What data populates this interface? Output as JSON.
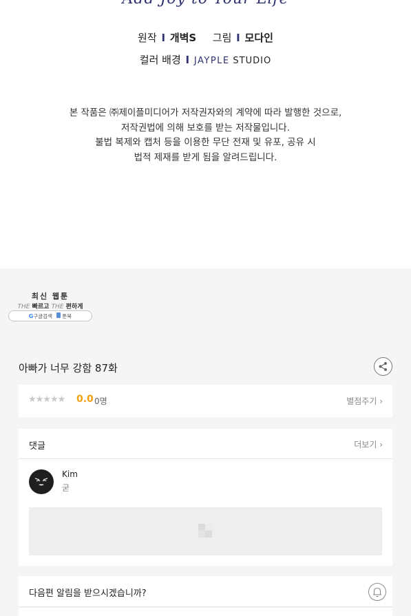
{
  "header": {
    "cut_title": "Add Joy to Your Life"
  },
  "credits": {
    "original_label": "원작",
    "original_name": "개벽S",
    "art_label": "그림",
    "art_name": "모다인",
    "color_label": "컬러 배경",
    "separator": "I",
    "studio_brand": "JAYPLE",
    "studio_word": "STUDIO"
  },
  "notice": {
    "line1": "본 작품은 ㈜제이플미디어가 저작권자와의 계약에 따라 발행한 것으로,",
    "line2": "저작권법에 의해 보호를 받는 저작물입니다.",
    "line3": "불법 복제와 캡처 등을 이용한 무단 전재 및 유포, 공유 시",
    "line4": "법적 제재를 받게 됨을 알려드립니다."
  },
  "banner": {
    "title": "최신 웹툰",
    "the1": "THE",
    "fast": "빠르고",
    "the2": "THE",
    "easy": "편하게",
    "google_g": "G",
    "google_label": "구글검색",
    "site_label": "툰북"
  },
  "episode": {
    "title": "아빠가 너무 강함 87화",
    "share_icon": "share-icon"
  },
  "rating": {
    "stars": "★★★★★",
    "score": "0.0",
    "count": "0명",
    "rate_link": "별점주기 ›",
    "star_color": "#c9c9c9",
    "score_color": "#f2a20c"
  },
  "comments": {
    "label": "댓글",
    "more_link": "더보기 ›",
    "items": [
      {
        "user": "Kim",
        "text": "굳"
      }
    ]
  },
  "notify": {
    "question": "다음편 알림을 받으시겠습니까?",
    "icon": "bell-icon"
  },
  "colors": {
    "accent_navy": "#2f3270",
    "section_bg": "#f5f5f5"
  }
}
